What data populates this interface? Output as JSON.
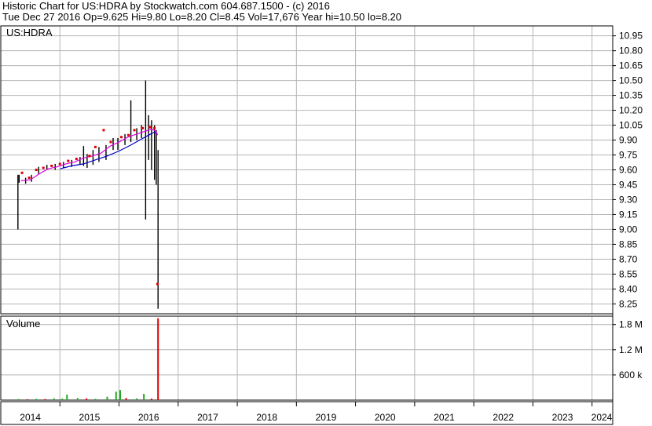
{
  "header": {
    "line1": "Historic Chart for US:HDRA by Stockwatch.com 604.687.1500 - (c) 2016",
    "line2": "Tue Dec 27 2016  Op=9.625  Hi=9.80  Lo=8.20  Cl=8.45  Vol=17,676  Year hi=10.50  lo=8.20"
  },
  "colors": {
    "grid": "#b4b4b4",
    "price_bar": "#000000",
    "ma_short": "#dd00dd",
    "ma_long": "#0000cc",
    "dot": "#dd0000",
    "volume_up": "#22aa22",
    "volume_down": "#dd0000"
  },
  "chart_data": [
    {
      "type": "line",
      "panel": "price",
      "title": "US:HDRA",
      "ylim": [
        8.15,
        11.05
      ],
      "y_ticks": [
        "10.95",
        "10.80",
        "10.65",
        "10.50",
        "10.35",
        "10.20",
        "10.05",
        "9.90",
        "9.75",
        "9.60",
        "9.45",
        "9.30",
        "9.15",
        "9.00",
        "8.85",
        "8.70",
        "8.55",
        "8.40",
        "8.25"
      ],
      "x_range": [
        2014.0,
        2024.35
      ],
      "price_bars": [
        {
          "x": 2014.29,
          "low": 9.0,
          "high": 9.55
        },
        {
          "x": 2014.31,
          "low": 9.47,
          "high": 9.55
        },
        {
          "x": 2014.42,
          "low": 9.46,
          "high": 9.52
        },
        {
          "x": 2014.52,
          "low": 9.48,
          "high": 9.55
        },
        {
          "x": 2014.64,
          "low": 9.56,
          "high": 9.63
        },
        {
          "x": 2014.78,
          "low": 9.6,
          "high": 9.65
        },
        {
          "x": 2014.92,
          "low": 9.6,
          "high": 9.66
        },
        {
          "x": 2015.06,
          "low": 9.62,
          "high": 9.68
        },
        {
          "x": 2015.2,
          "low": 9.63,
          "high": 9.7
        },
        {
          "x": 2015.34,
          "low": 9.65,
          "high": 9.73
        },
        {
          "x": 2015.4,
          "low": 9.64,
          "high": 9.84
        },
        {
          "x": 2015.46,
          "low": 9.62,
          "high": 9.76
        },
        {
          "x": 2015.56,
          "low": 9.65,
          "high": 9.8
        },
        {
          "x": 2015.66,
          "low": 9.68,
          "high": 9.83
        },
        {
          "x": 2015.78,
          "low": 9.7,
          "high": 9.85
        },
        {
          "x": 2015.9,
          "low": 9.8,
          "high": 9.92
        },
        {
          "x": 2015.98,
          "low": 9.8,
          "high": 9.92
        },
        {
          "x": 2016.1,
          "low": 9.85,
          "high": 9.96
        },
        {
          "x": 2016.2,
          "low": 9.88,
          "high": 10.3
        },
        {
          "x": 2016.3,
          "low": 9.9,
          "high": 10.02
        },
        {
          "x": 2016.38,
          "low": 9.92,
          "high": 10.05
        },
        {
          "x": 2016.45,
          "low": 9.1,
          "high": 10.5
        },
        {
          "x": 2016.5,
          "low": 9.7,
          "high": 10.15
        },
        {
          "x": 2016.55,
          "low": 9.6,
          "high": 10.1
        },
        {
          "x": 2016.6,
          "low": 9.5,
          "high": 10.05
        },
        {
          "x": 2016.63,
          "low": 9.45,
          "high": 10.0
        },
        {
          "x": 2016.66,
          "low": 8.2,
          "high": 9.8
        }
      ],
      "ma_short_points": [
        [
          2014.34,
          9.49
        ],
        [
          2014.5,
          9.5
        ],
        [
          2014.65,
          9.56
        ],
        [
          2014.8,
          9.61
        ],
        [
          2014.95,
          9.63
        ],
        [
          2015.1,
          9.66
        ],
        [
          2015.25,
          9.68
        ],
        [
          2015.4,
          9.72
        ],
        [
          2015.55,
          9.74
        ],
        [
          2015.7,
          9.77
        ],
        [
          2015.85,
          9.84
        ],
        [
          2016.0,
          9.88
        ],
        [
          2016.15,
          9.93
        ],
        [
          2016.3,
          9.96
        ],
        [
          2016.45,
          9.99
        ],
        [
          2016.55,
          10.01
        ],
        [
          2016.62,
          9.99
        ],
        [
          2016.65,
          9.95
        ]
      ],
      "ma_long_points": [
        [
          2015.0,
          9.61
        ],
        [
          2015.2,
          9.64
        ],
        [
          2015.4,
          9.66
        ],
        [
          2015.6,
          9.7
        ],
        [
          2015.8,
          9.74
        ],
        [
          2016.0,
          9.79
        ],
        [
          2016.2,
          9.85
        ],
        [
          2016.35,
          9.9
        ],
        [
          2016.5,
          9.95
        ],
        [
          2016.6,
          9.98
        ],
        [
          2016.65,
          9.96
        ]
      ],
      "dots": [
        [
          2014.36,
          9.57
        ],
        [
          2014.48,
          9.52
        ],
        [
          2014.6,
          9.6
        ],
        [
          2014.72,
          9.62
        ],
        [
          2014.86,
          9.64
        ],
        [
          2015.0,
          9.66
        ],
        [
          2015.14,
          9.69
        ],
        [
          2015.28,
          9.71
        ],
        [
          2015.5,
          9.74
        ],
        [
          2015.6,
          9.83
        ],
        [
          2015.74,
          10.0
        ],
        [
          2015.86,
          9.88
        ],
        [
          2016.04,
          9.93
        ],
        [
          2016.16,
          9.95
        ],
        [
          2016.26,
          10.0
        ],
        [
          2016.4,
          10.02
        ],
        [
          2016.52,
          10.03
        ],
        [
          2016.6,
          10.02
        ],
        [
          2016.65,
          8.45
        ]
      ]
    },
    {
      "type": "bar",
      "panel": "volume",
      "title": "Volume",
      "ylim": [
        0,
        2000000
      ],
      "y_ticks": [
        {
          "value": 1800000,
          "label": "1.8 M"
        },
        {
          "value": 1200000,
          "label": "1.2 M"
        },
        {
          "value": 600000,
          "label": "600 k"
        }
      ],
      "bars": [
        {
          "x": 2014.3,
          "value": 25000,
          "dir": "up"
        },
        {
          "x": 2014.45,
          "value": 20000,
          "dir": "down"
        },
        {
          "x": 2014.6,
          "value": 30000,
          "dir": "up"
        },
        {
          "x": 2014.75,
          "value": 25000,
          "dir": "down"
        },
        {
          "x": 2014.9,
          "value": 40000,
          "dir": "up"
        },
        {
          "x": 2015.04,
          "value": 35000,
          "dir": "up"
        },
        {
          "x": 2015.12,
          "value": 130000,
          "dir": "up"
        },
        {
          "x": 2015.3,
          "value": 50000,
          "dir": "up"
        },
        {
          "x": 2015.45,
          "value": 40000,
          "dir": "down"
        },
        {
          "x": 2015.6,
          "value": 30000,
          "dir": "up"
        },
        {
          "x": 2015.8,
          "value": 80000,
          "dir": "up"
        },
        {
          "x": 2015.95,
          "value": 200000,
          "dir": "up"
        },
        {
          "x": 2016.02,
          "value": 240000,
          "dir": "up"
        },
        {
          "x": 2016.12,
          "value": 50000,
          "dir": "down"
        },
        {
          "x": 2016.3,
          "value": 40000,
          "dir": "up"
        },
        {
          "x": 2016.42,
          "value": 150000,
          "dir": "up"
        },
        {
          "x": 2016.55,
          "value": 35000,
          "dir": "down"
        },
        {
          "x": 2016.66,
          "value": 1950000,
          "dir": "down"
        }
      ]
    },
    {
      "type": "axis",
      "panel": "years",
      "years": [
        "2014",
        "2015",
        "2016",
        "2017",
        "2018",
        "2019",
        "2020",
        "2021",
        "2022",
        "2023",
        "2024"
      ]
    }
  ]
}
